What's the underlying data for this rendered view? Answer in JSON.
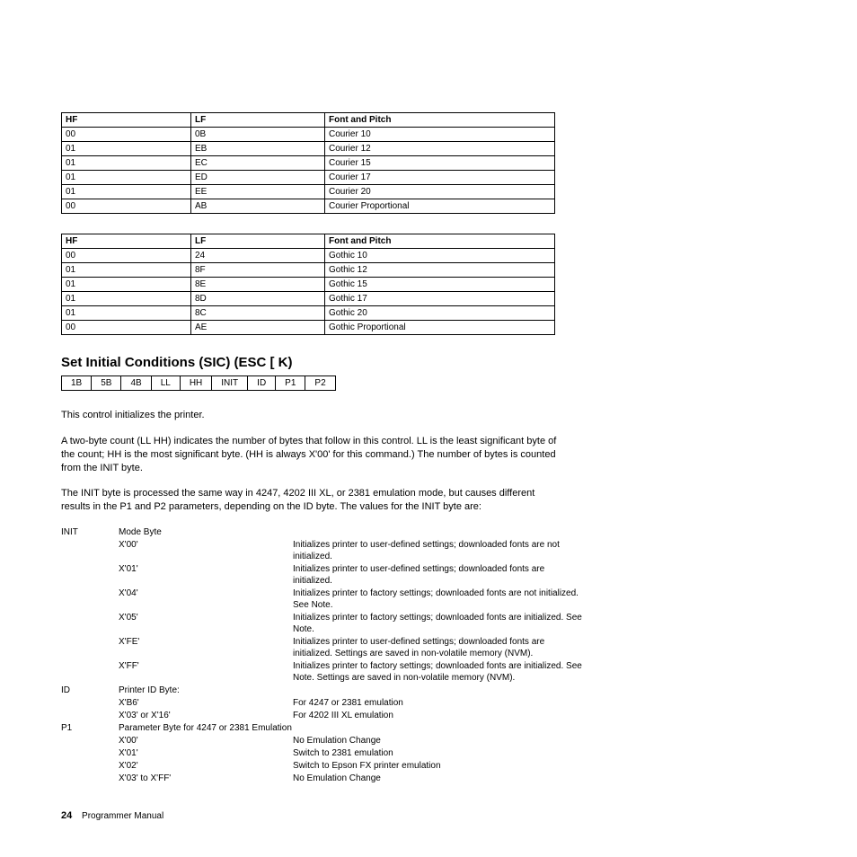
{
  "table1": {
    "headers": [
      "HF",
      "LF",
      "Font and Pitch"
    ],
    "rows": [
      [
        "00",
        "0B",
        "Courier 10"
      ],
      [
        "01",
        "EB",
        "Courier 12"
      ],
      [
        "01",
        "EC",
        "Courier 15"
      ],
      [
        "01",
        "ED",
        "Courier 17"
      ],
      [
        "01",
        "EE",
        "Courier 20"
      ],
      [
        "00",
        "AB",
        "Courier Proportional"
      ]
    ]
  },
  "table2": {
    "headers": [
      "HF",
      "LF",
      "Font and Pitch"
    ],
    "rows": [
      [
        "00",
        "24",
        "Gothic 10"
      ],
      [
        "01",
        "8F",
        "Gothic 12"
      ],
      [
        "01",
        "8E",
        "Gothic 15"
      ],
      [
        "01",
        "8D",
        "Gothic 17"
      ],
      [
        "01",
        "8C",
        "Gothic 20"
      ],
      [
        "00",
        "AE",
        "Gothic Proportional"
      ]
    ]
  },
  "section_title": "Set Initial Conditions (SIC) (ESC [ K)",
  "byte_seq": [
    "1B",
    "5B",
    "4B",
    "LL",
    "HH",
    "INIT",
    "ID",
    "P1",
    "P2"
  ],
  "para1": "This control initializes the printer.",
  "para2": "A two-byte count (LL HH) indicates the number of bytes that follow in this control. LL is the least significant byte of the count; HH is the most significant byte. (HH is always X'00' for this command.) The number of bytes is counted from the INIT byte.",
  "para3": "The INIT byte is processed the same way in 4247, 4202 III XL, or 2381 emulation mode, but causes different results in the P1 and P2 parameters, depending on the ID byte. The values for the INIT byte are:",
  "defs": {
    "init_key": "INIT",
    "init_label": "Mode Byte",
    "init_rows": [
      [
        "X'00'",
        "Initializes printer to user-defined settings; downloaded fonts are not initialized."
      ],
      [
        "X'01'",
        "Initializes printer to user-defined settings; downloaded fonts are initialized."
      ],
      [
        "X'04'",
        "Initializes printer to factory settings; downloaded fonts are not initialized. See Note."
      ],
      [
        "X'05'",
        "Initializes printer to factory settings; downloaded fonts are initialized. See Note."
      ],
      [
        "X'FE'",
        "Initializes printer to user-defined settings; downloaded fonts are initialized. Settings are saved in non-volatile memory (NVM)."
      ],
      [
        "X'FF'",
        "Initializes printer to factory settings; downloaded fonts are initialized. See Note. Settings are saved in non-volatile memory (NVM)."
      ]
    ],
    "id_key": "ID",
    "id_label": "Printer ID Byte:",
    "id_rows": [
      [
        "X'B6'",
        "For 4247 or 2381 emulation"
      ],
      [
        "X'03' or X'16'",
        "For 4202 III XL emulation"
      ]
    ],
    "p1_key": "P1",
    "p1_label": "Parameter Byte for 4247 or 2381 Emulation",
    "p1_rows": [
      [
        "X'00'",
        "No Emulation Change"
      ],
      [
        "X'01'",
        "Switch to 2381 emulation"
      ],
      [
        "X'02'",
        "Switch to Epson FX printer emulation"
      ],
      [
        "X'03' to X'FF'",
        "No Emulation Change"
      ]
    ]
  },
  "footer": {
    "page_number": "24",
    "doc_title": "Programmer Manual"
  }
}
